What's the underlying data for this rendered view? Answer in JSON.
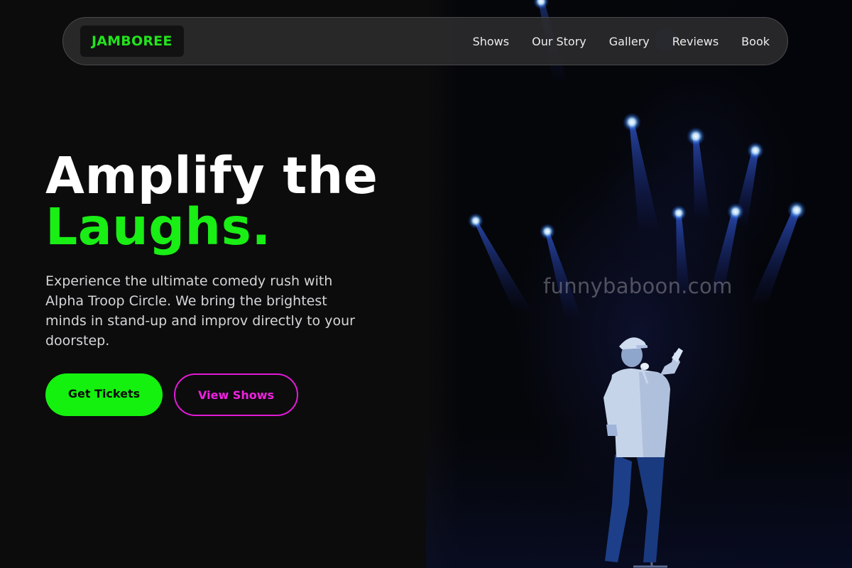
{
  "brand": {
    "logo_text": "JAMBOREE",
    "accent_color": "#19ee15",
    "secondary_color": "#e21ad6"
  },
  "nav": {
    "links": [
      "Shows",
      "Our Story",
      "Gallery",
      "Reviews",
      "Book"
    ]
  },
  "hero": {
    "title_line1": "Amplify the",
    "title_line2": "Laughs.",
    "description": "Experience the ultimate comedy rush with Alpha Troop Circle. We bring the brightest minds in stand-up and improv directly to your doorstep.",
    "primary_button": "Get Tickets",
    "secondary_button": "View Shows"
  },
  "image": {
    "watermark": "funnybaboon.com"
  }
}
